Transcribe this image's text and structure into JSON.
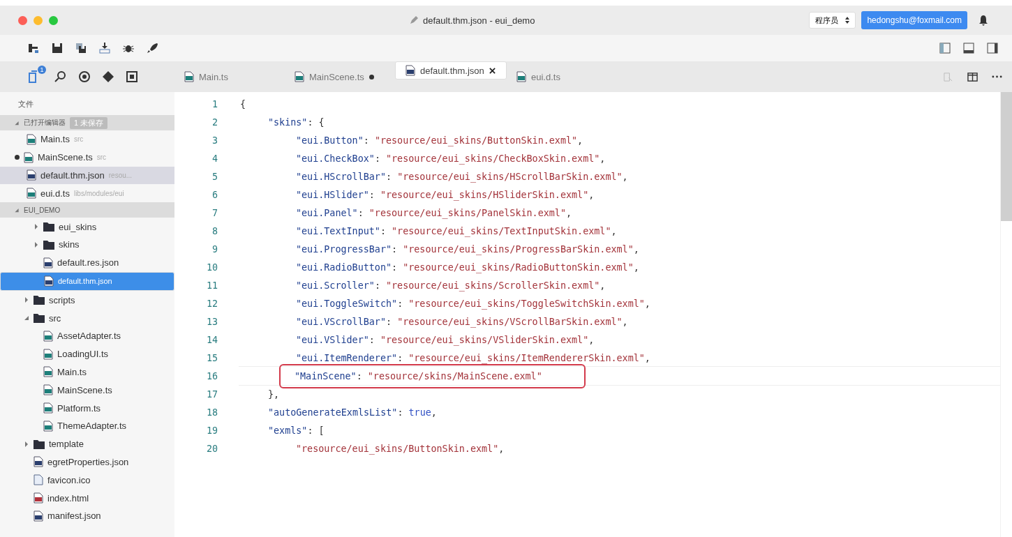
{
  "window": {
    "title": "default.thm.json - eui_demo",
    "role_select": "程序员",
    "account": "hedongshu@foxmail.com"
  },
  "activity_bar": [
    {
      "kind": "files",
      "badge": "1",
      "selected": true
    },
    {
      "kind": "search",
      "selected": false
    },
    {
      "kind": "debug",
      "selected": false
    },
    {
      "kind": "git",
      "selected": false
    },
    {
      "kind": "extensions",
      "selected": false
    }
  ],
  "tabs": [
    {
      "label": "Main.ts",
      "kind": "ts",
      "selected": false,
      "dirty": false
    },
    {
      "label": "MainScene.ts",
      "kind": "ts",
      "selected": false,
      "dirty": true
    },
    {
      "label": "default.thm.json",
      "kind": "json",
      "selected": true,
      "dirty": false
    },
    {
      "label": "eui.d.ts",
      "kind": "ts",
      "selected": false,
      "dirty": false
    }
  ],
  "sidebar": {
    "title": "文件",
    "open_editors": {
      "label": "已打开编辑器",
      "badge": "1 未保存",
      "expanded": true,
      "items": [
        {
          "name": "Main.ts",
          "path": "src",
          "kind": "ts",
          "dirty": false,
          "selected": false
        },
        {
          "name": "MainScene.ts",
          "path": "src",
          "kind": "ts",
          "dirty": true,
          "selected": false
        },
        {
          "name": "default.thm.json",
          "path": "resou...",
          "kind": "json",
          "dirty": false,
          "selected": true
        },
        {
          "name": "eui.d.ts",
          "path": "libs/modules/eui",
          "kind": "ts",
          "dirty": false,
          "selected": false
        }
      ]
    },
    "project": {
      "label": "EUI_DEMO",
      "expanded": true,
      "items": [
        {
          "name": "eui_skins",
          "kind": "folder",
          "expanded": false,
          "selected": false
        },
        {
          "name": "skins",
          "kind": "folder",
          "expanded": false,
          "selected": false
        },
        {
          "name": "default.res.json",
          "kind": "json",
          "selected": false
        },
        {
          "name": "default.thm.json",
          "kind": "json",
          "selected": true
        }
      ]
    },
    "tree": [
      {
        "name": "scripts",
        "kind": "folder",
        "expanded": false,
        "selected": false
      },
      {
        "name": "src",
        "kind": "folder",
        "expanded": true,
        "selected": false,
        "children": [
          {
            "name": "AssetAdapter.ts",
            "kind": "ts",
            "selected": false
          },
          {
            "name": "LoadingUI.ts",
            "kind": "ts",
            "selected": false
          },
          {
            "name": "Main.ts",
            "kind": "ts",
            "selected": false
          },
          {
            "name": "MainScene.ts",
            "kind": "ts",
            "selected": false
          },
          {
            "name": "Platform.ts",
            "kind": "ts",
            "selected": false
          },
          {
            "name": "ThemeAdapter.ts",
            "kind": "ts",
            "selected": false
          }
        ]
      },
      {
        "name": "template",
        "kind": "folder",
        "expanded": false,
        "selected": false
      },
      {
        "name": "egretProperties.json",
        "kind": "json",
        "selected": false
      },
      {
        "name": "favicon.ico",
        "kind": "ico",
        "selected": false
      },
      {
        "name": "index.html",
        "kind": "html",
        "selected": false
      },
      {
        "name": "manifest.json",
        "kind": "json",
        "selected": false
      }
    ]
  },
  "editor": {
    "lines": [
      {
        "n": "1",
        "boxed": false,
        "parts": [
          {
            "kind": "punct",
            "text": "{"
          }
        ],
        "children": [
          {
            "n": "2",
            "boxed": false,
            "parts": [
              {
                "kind": "key",
                "text": "\"skins\""
              },
              {
                "kind": "punct",
                "text": ": {"
              }
            ],
            "children": [
              {
                "n": "3",
                "boxed": false,
                "parts": [
                  {
                    "kind": "key",
                    "text": "\"eui.Button\""
                  },
                  {
                    "kind": "punct",
                    "text": ": "
                  },
                  {
                    "kind": "string",
                    "text": "\"resource/eui_skins/ButtonSkin.exml\""
                  },
                  {
                    "kind": "punct",
                    "text": ","
                  }
                ]
              },
              {
                "n": "4",
                "boxed": false,
                "parts": [
                  {
                    "kind": "key",
                    "text": "\"eui.CheckBox\""
                  },
                  {
                    "kind": "punct",
                    "text": ": "
                  },
                  {
                    "kind": "string",
                    "text": "\"resource/eui_skins/CheckBoxSkin.exml\""
                  },
                  {
                    "kind": "punct",
                    "text": ","
                  }
                ]
              },
              {
                "n": "5",
                "boxed": false,
                "parts": [
                  {
                    "kind": "key",
                    "text": "\"eui.HScrollBar\""
                  },
                  {
                    "kind": "punct",
                    "text": ": "
                  },
                  {
                    "kind": "string",
                    "text": "\"resource/eui_skins/HScrollBarSkin.exml\""
                  },
                  {
                    "kind": "punct",
                    "text": ","
                  }
                ]
              },
              {
                "n": "6",
                "boxed": false,
                "parts": [
                  {
                    "kind": "key",
                    "text": "\"eui.HSlider\""
                  },
                  {
                    "kind": "punct",
                    "text": ": "
                  },
                  {
                    "kind": "string",
                    "text": "\"resource/eui_skins/HSliderSkin.exml\""
                  },
                  {
                    "kind": "punct",
                    "text": ","
                  }
                ]
              },
              {
                "n": "7",
                "boxed": false,
                "parts": [
                  {
                    "kind": "key",
                    "text": "\"eui.Panel\""
                  },
                  {
                    "kind": "punct",
                    "text": ": "
                  },
                  {
                    "kind": "string",
                    "text": "\"resource/eui_skins/PanelSkin.exml\""
                  },
                  {
                    "kind": "punct",
                    "text": ","
                  }
                ]
              },
              {
                "n": "8",
                "boxed": false,
                "parts": [
                  {
                    "kind": "key",
                    "text": "\"eui.TextInput\""
                  },
                  {
                    "kind": "punct",
                    "text": ": "
                  },
                  {
                    "kind": "string",
                    "text": "\"resource/eui_skins/TextInputSkin.exml\""
                  },
                  {
                    "kind": "punct",
                    "text": ","
                  }
                ]
              },
              {
                "n": "9",
                "boxed": false,
                "parts": [
                  {
                    "kind": "key",
                    "text": "\"eui.ProgressBar\""
                  },
                  {
                    "kind": "punct",
                    "text": ": "
                  },
                  {
                    "kind": "string",
                    "text": "\"resource/eui_skins/ProgressBarSkin.exml\""
                  },
                  {
                    "kind": "punct",
                    "text": ","
                  }
                ]
              },
              {
                "n": "10",
                "boxed": false,
                "parts": [
                  {
                    "kind": "key",
                    "text": "\"eui.RadioButton\""
                  },
                  {
                    "kind": "punct",
                    "text": ": "
                  },
                  {
                    "kind": "string",
                    "text": "\"resource/eui_skins/RadioButtonSkin.exml\""
                  },
                  {
                    "kind": "punct",
                    "text": ","
                  }
                ]
              },
              {
                "n": "11",
                "boxed": false,
                "parts": [
                  {
                    "kind": "key",
                    "text": "\"eui.Scroller\""
                  },
                  {
                    "kind": "punct",
                    "text": ": "
                  },
                  {
                    "kind": "string",
                    "text": "\"resource/eui_skins/ScrollerSkin.exml\""
                  },
                  {
                    "kind": "punct",
                    "text": ","
                  }
                ]
              },
              {
                "n": "12",
                "boxed": false,
                "parts": [
                  {
                    "kind": "key",
                    "text": "\"eui.ToggleSwitch\""
                  },
                  {
                    "kind": "punct",
                    "text": ": "
                  },
                  {
                    "kind": "string",
                    "text": "\"resource/eui_skins/ToggleSwitchSkin.exml\""
                  },
                  {
                    "kind": "punct",
                    "text": ","
                  }
                ]
              },
              {
                "n": "13",
                "boxed": false,
                "parts": [
                  {
                    "kind": "key",
                    "text": "\"eui.VScrollBar\""
                  },
                  {
                    "kind": "punct",
                    "text": ": "
                  },
                  {
                    "kind": "string",
                    "text": "\"resource/eui_skins/VScrollBarSkin.exml\""
                  },
                  {
                    "kind": "punct",
                    "text": ","
                  }
                ]
              },
              {
                "n": "14",
                "boxed": false,
                "parts": [
                  {
                    "kind": "key",
                    "text": "\"eui.VSlider\""
                  },
                  {
                    "kind": "punct",
                    "text": ": "
                  },
                  {
                    "kind": "string",
                    "text": "\"resource/eui_skins/VSliderSkin.exml\""
                  },
                  {
                    "kind": "punct",
                    "text": ","
                  }
                ]
              },
              {
                "n": "15",
                "boxed": false,
                "parts": [
                  {
                    "kind": "key",
                    "text": "\"eui.ItemRenderer\""
                  },
                  {
                    "kind": "punct",
                    "text": ": "
                  },
                  {
                    "kind": "string",
                    "text": "\"resource/eui_skins/ItemRendererSkin.exml\""
                  },
                  {
                    "kind": "punct",
                    "text": ","
                  }
                ]
              },
              {
                "n": "16",
                "boxed": true,
                "parts": [
                  {
                    "kind": "key",
                    "text": "\"MainScene\""
                  },
                  {
                    "kind": "punct",
                    "text": ": "
                  },
                  {
                    "kind": "string",
                    "text": "\"resource/skins/MainScene.exml\""
                  }
                ]
              }
            ]
          },
          {
            "n": "17",
            "boxed": false,
            "parts": [
              {
                "kind": "punct",
                "text": "},"
              }
            ]
          },
          {
            "n": "18",
            "boxed": false,
            "parts": [
              {
                "kind": "key",
                "text": "\"autoGenerateExmlsList\""
              },
              {
                "kind": "punct",
                "text": ": "
              },
              {
                "kind": "literal",
                "text": "true"
              },
              {
                "kind": "punct",
                "text": ","
              }
            ]
          },
          {
            "n": "19",
            "boxed": false,
            "parts": [
              {
                "kind": "key",
                "text": "\"exmls\""
              },
              {
                "kind": "punct",
                "text": ": ["
              }
            ],
            "children": [
              {
                "n": "20",
                "boxed": false,
                "parts": [
                  {
                    "kind": "string",
                    "text": "\"resource/eui_skins/ButtonSkin.exml\""
                  },
                  {
                    "kind": "punct",
                    "text": ","
                  }
                ]
              }
            ]
          }
        ]
      }
    ]
  }
}
